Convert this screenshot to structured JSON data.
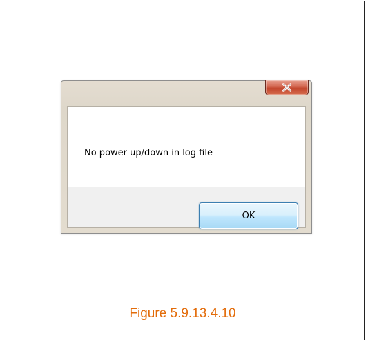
{
  "dialog": {
    "close_glyph": "x",
    "message": "No power up/down in log file",
    "ok_label": "OK"
  },
  "figure": {
    "caption": "Figure 5.9.13.4.10",
    "caption_color": "#e36c0a"
  },
  "colors": {
    "close_button": "#c7523a",
    "ok_button_border": "#3c7fb1",
    "button_area_bg": "#f0f0f0"
  }
}
